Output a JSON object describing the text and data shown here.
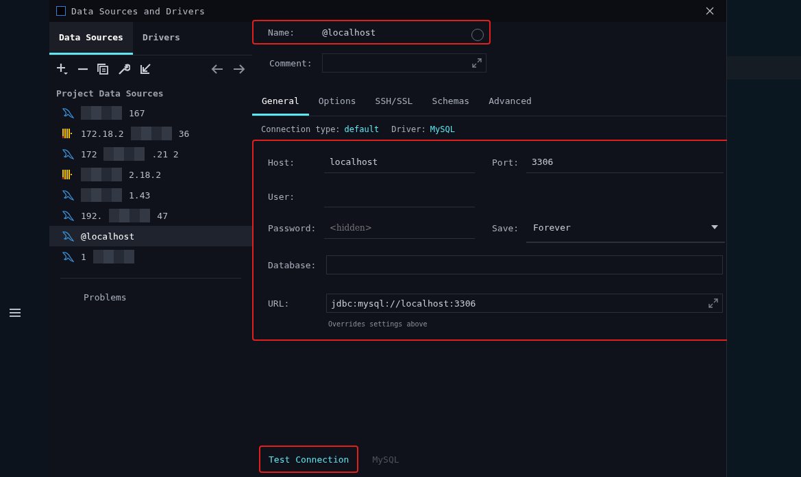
{
  "window": {
    "title": "Data Sources and Drivers"
  },
  "left_tabs": [
    {
      "label": "Data Sources",
      "selected": true
    },
    {
      "label": "Drivers",
      "selected": false
    }
  ],
  "section_title": "Project Data Sources",
  "sources": [
    {
      "kind": "dolphin",
      "suffix": "167",
      "redacted": true,
      "selected": false
    },
    {
      "kind": "bars",
      "prefix": "172.18.2",
      "suffix": "36",
      "redacted": true,
      "selected": false
    },
    {
      "kind": "dolphin",
      "prefix": "172",
      "suffix": ".21 2",
      "redacted": true,
      "selected": false
    },
    {
      "kind": "bars",
      "suffix": "2.18.2",
      "redacted": true,
      "selected": false
    },
    {
      "kind": "dolphin",
      "suffix": "1.43",
      "redacted": true,
      "selected": false
    },
    {
      "kind": "dolphin",
      "prefix": "192.",
      "suffix": "47",
      "redacted": true,
      "selected": false
    },
    {
      "kind": "dolphin",
      "prefix": "@localhost",
      "redacted": false,
      "selected": true
    },
    {
      "kind": "dolphin",
      "prefix": "1",
      "redacted": true,
      "selected": false
    }
  ],
  "problems": "Problems",
  "name": {
    "label": "Name:",
    "value": "@localhost"
  },
  "comment": {
    "label": "Comment:"
  },
  "tabs": [
    {
      "label": "General",
      "selected": true
    },
    {
      "label": "Options",
      "selected": false
    },
    {
      "label": "SSH/SSL",
      "selected": false
    },
    {
      "label": "Schemas",
      "selected": false
    },
    {
      "label": "Advanced",
      "selected": false
    }
  ],
  "connection_type": {
    "label": "Connection type:",
    "value": "default"
  },
  "driver": {
    "label": "Driver:",
    "value": "MySQL"
  },
  "host": {
    "label": "Host:",
    "value": "localhost"
  },
  "port": {
    "label": "Port:",
    "value": "3306"
  },
  "user": {
    "label": "User:"
  },
  "password": {
    "label": "Password:",
    "placeholder": "<hidden>"
  },
  "save": {
    "label": "Save:",
    "value": "Forever"
  },
  "database": {
    "label": "Database:"
  },
  "url": {
    "label": "URL:",
    "value": "jdbc:mysql://localhost:3306",
    "hint": "Overrides settings above"
  },
  "footer": {
    "test_button": "Test Connection",
    "driver_link": "MySQL"
  }
}
